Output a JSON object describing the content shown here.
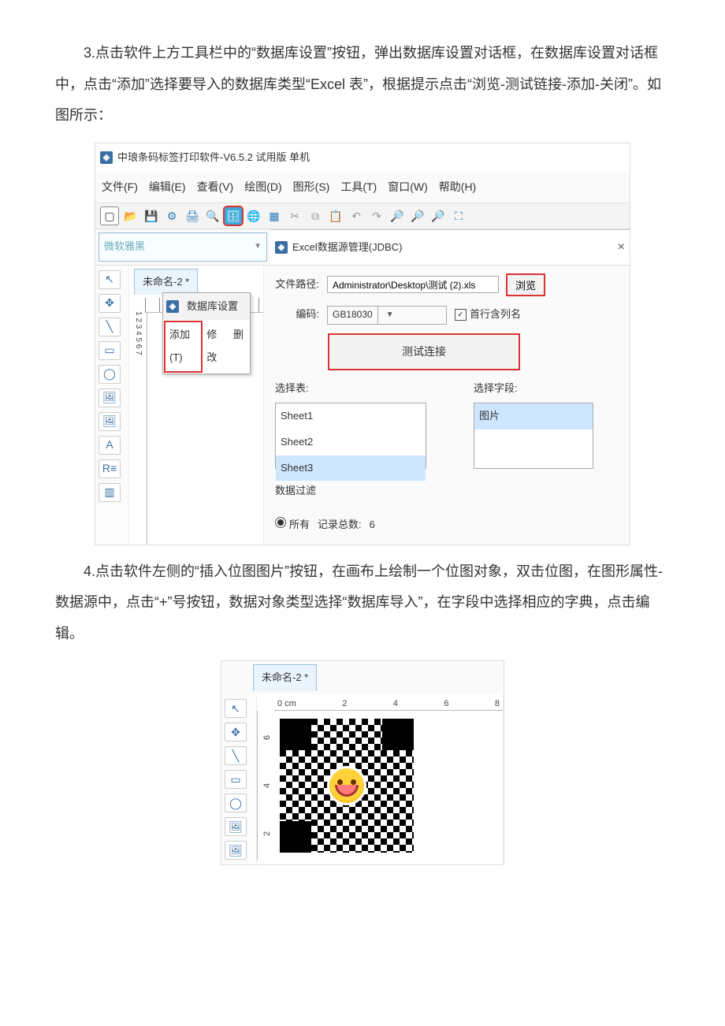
{
  "para1": "3.点击软件上方工具栏中的“数据库设置”按钮，弹出数据库设置对话框，在数据库设置对话框中，点击“添加”选择要导入的数据库类型“Excel 表”，根据提示点击“浏览-测试链接-添加-关闭”。如图所示：",
  "para2": "4.点击软件左侧的“插入位图图片”按钮，在画布上绘制一个位图对象，双击位图，在图形属性-数据源中，点击“+”号按钮，数据对象类型选择“数据库导入”，在字段中选择相应的字典，点击编辑。",
  "app": {
    "title": "中琅条码标签打印软件-V6.5.2 试用版 单机",
    "menus": [
      "文件(F)",
      "编辑(E)",
      "查看(V)",
      "绘图(D)",
      "图形(S)",
      "工具(T)",
      "窗口(W)",
      "帮助(H)"
    ],
    "font_combo": "微软雅黑",
    "document_tab": "未命名-2 *",
    "context_menu": {
      "title": "数据库设置",
      "items": [
        "添加(T)",
        "修改",
        "删"
      ]
    },
    "ruler_v_marks": [
      "1",
      "2",
      "3",
      "4",
      "5",
      "6",
      "7"
    ]
  },
  "dlg": {
    "title": "Excel数据源管理(JDBC)",
    "labels": {
      "path": "文件路径:",
      "enc": "编码:",
      "select_table": "选择表:",
      "select_field": "选择字段:",
      "filter": "数据过滤"
    },
    "path_value": "Administrator\\Desktop\\测试 (2).xls",
    "browse": "浏览",
    "enc_value": "GB18030",
    "first_row": "首行含列名",
    "test": "测试连接",
    "tables": [
      "Sheet1",
      "Sheet2",
      "Sheet3"
    ],
    "tables_selected": 2,
    "fields": [
      "图片"
    ],
    "filter_all": "所有",
    "record_label": "记录总数:",
    "record_total": "6"
  },
  "shot2": {
    "tab": "未命名-2 *",
    "h_marks": [
      "0 cm",
      "2",
      "4",
      "6",
      "8"
    ],
    "v_marks": [
      "2",
      "4",
      "6"
    ]
  }
}
